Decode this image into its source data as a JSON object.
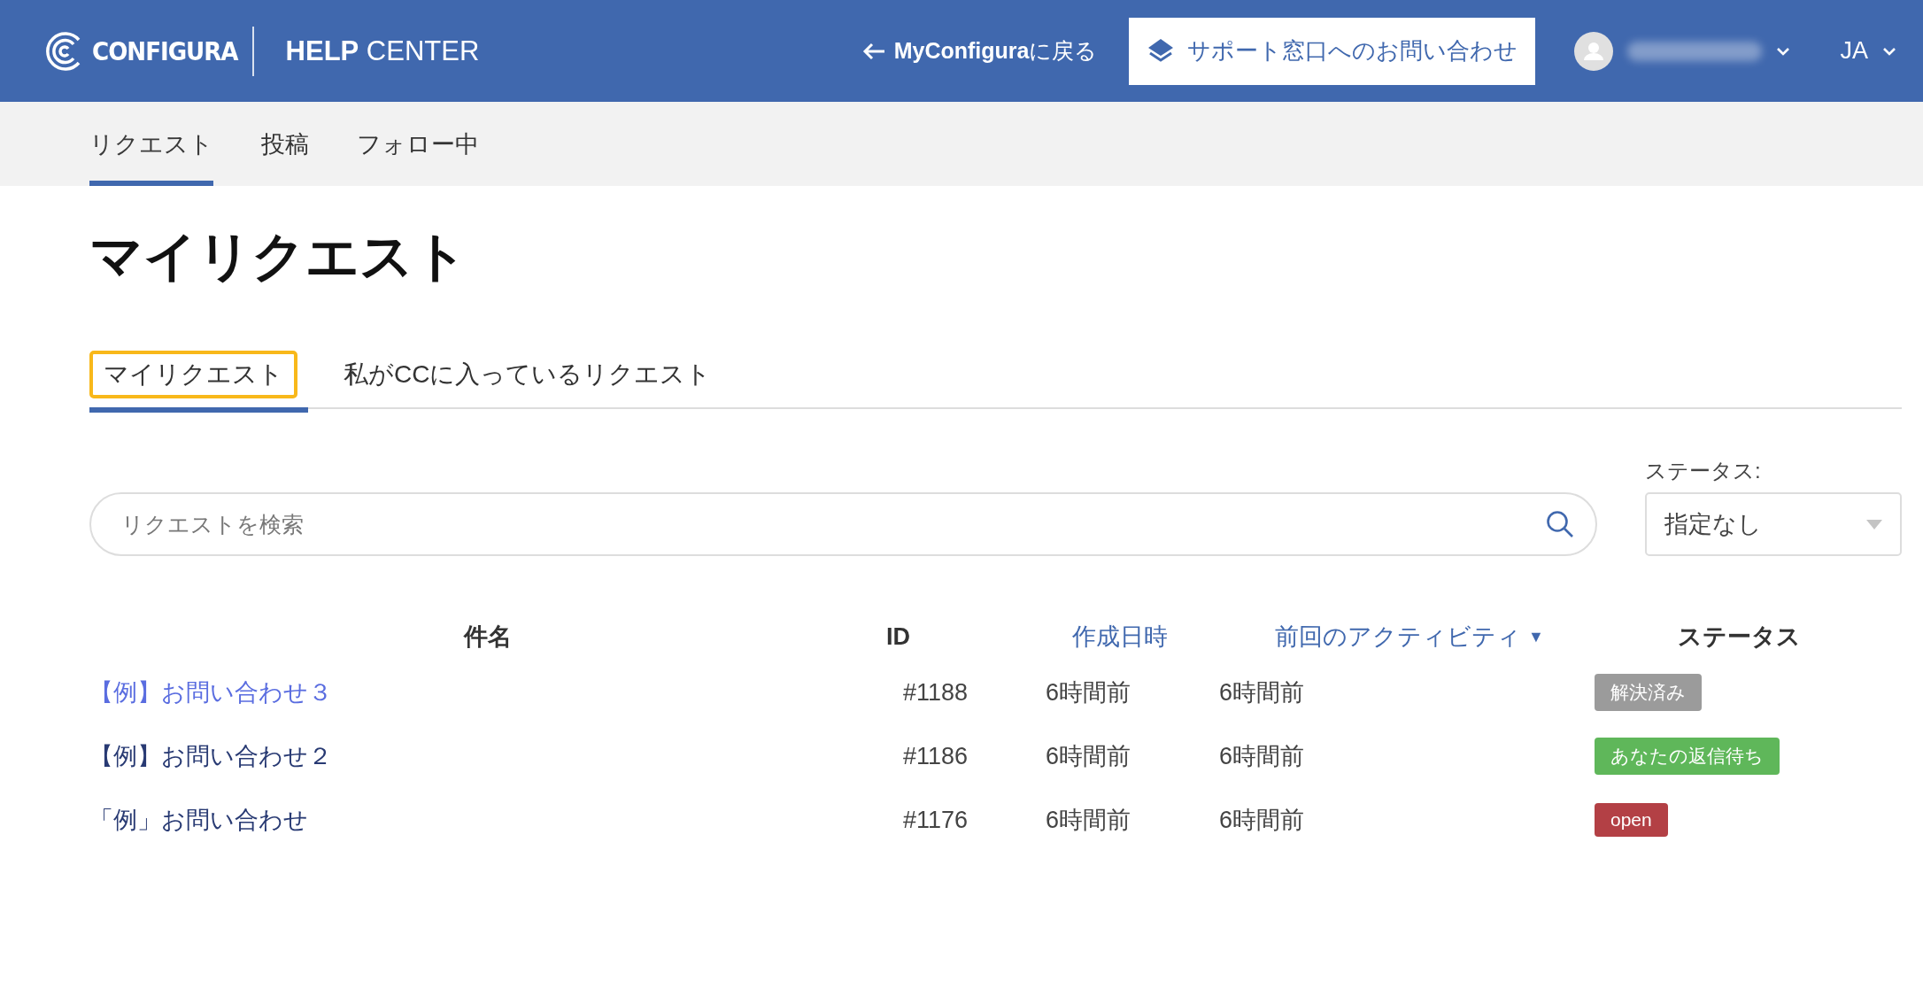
{
  "header": {
    "logo": "CONFIGURA",
    "section": "**HELP** CENTER",
    "back_link": "**MyConfigura**に戻る",
    "support_button": "サポート窓口へのお問い合わせ",
    "language": "JA"
  },
  "nav": [
    {
      "label": "リクエスト",
      "selected": true
    },
    {
      "label": "投稿",
      "selected": false
    },
    {
      "label": "フォロー中",
      "selected": false
    }
  ],
  "title": "マイリクエスト",
  "tabs": [
    {
      "label": "マイリクエスト",
      "selected": true,
      "focused": true
    },
    {
      "label": "私がCCに入っているリクエスト",
      "selected": false,
      "focused": false
    }
  ],
  "search": {
    "placeholder": "リクエストを検索"
  },
  "status_filter": {
    "label": "ステータス:",
    "value": "指定なし"
  },
  "table": {
    "columns": [
      {
        "label": "件名",
        "kind": "plain"
      },
      {
        "label": "ID",
        "kind": "plain"
      },
      {
        "label": "作成日時",
        "kind": "sortable"
      },
      {
        "label": "前回のアクティビティ",
        "kind": "sortable",
        "sort_indicator": "▼"
      },
      {
        "label": "ステータス",
        "kind": "plain"
      }
    ],
    "rows": [
      {
        "subject": "【例】お問い合わせ３",
        "hovered": true,
        "id": "#1188",
        "created": "6時間前",
        "last_activity": "6時間前",
        "status": "解決済み",
        "color": "#9b9b9b"
      },
      {
        "subject": "【例】お問い合わせ２",
        "hovered": false,
        "id": "#1186",
        "created": "6時間前",
        "last_activity": "6時間前",
        "status": "あなたの返信待ち",
        "color": "#5fb75a"
      },
      {
        "subject": "「例」お問い合わせ",
        "hovered": false,
        "id": "#1176",
        "created": "6時間前",
        "last_activity": "6時間前",
        "status": "open",
        "color": "#b34045"
      }
    ]
  }
}
